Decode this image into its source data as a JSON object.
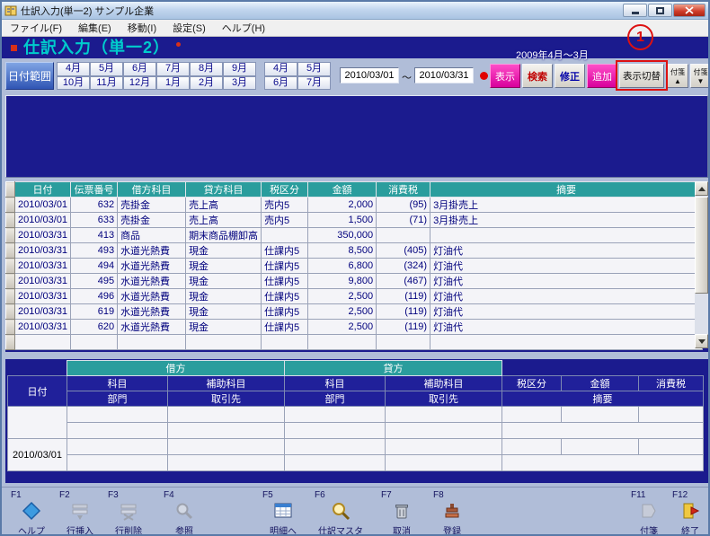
{
  "colors": {
    "navy": "#1b1b8e",
    "teal": "#2a9d9d",
    "magenta": "#d8009c",
    "annotation-red": "#dd1111",
    "cell-text": "#00007d"
  },
  "window": {
    "title": "仕訳入力(単一2) サンプル企業",
    "menus": [
      "ファイル(F)",
      "編集(E)",
      "移動(I)",
      "設定(S)",
      "ヘルプ(H)"
    ]
  },
  "header": {
    "title": "仕訳入力（単一2）",
    "period_label": "2009年4月～3月"
  },
  "annotation": {
    "number": "1"
  },
  "toolbar": {
    "date_range_label": "日付範囲",
    "months": [
      "4月",
      "5月",
      "6月",
      "7月",
      "8月",
      "9月",
      "10月",
      "11月",
      "12月",
      "1月",
      "2月",
      "3月"
    ],
    "quarter_months": [
      "4月",
      "5月",
      "6月",
      "7月"
    ],
    "date_from": "2010/03/01",
    "date_to": "2010/03/31",
    "tilde": "～",
    "buttons": {
      "display": "表示",
      "search": "検索",
      "modify": "修正",
      "add": "追加",
      "toggle_view": "表示切替",
      "fusen_up": "付箋▲",
      "fusen_down": "付箋▼"
    }
  },
  "journal_table": {
    "headers": [
      "日付",
      "伝票番号",
      "借方科目",
      "貸方科目",
      "税区分",
      "金額",
      "消費税",
      "摘要"
    ],
    "rows": [
      {
        "date": "2010/03/01",
        "no": "632",
        "debit": "売掛金",
        "credit": "売上高",
        "tax": "売内5",
        "amount": "2,000",
        "tax_amount": "(95)",
        "memo": "3月掛売上"
      },
      {
        "date": "2010/03/01",
        "no": "633",
        "debit": "売掛金",
        "credit": "売上高",
        "tax": "売内5",
        "amount": "1,500",
        "tax_amount": "(71)",
        "memo": "3月掛売上"
      },
      {
        "date": "2010/03/31",
        "no": "413",
        "debit": "商品",
        "credit": "期末商品棚卸高",
        "tax": "",
        "amount": "350,000",
        "tax_amount": "",
        "memo": ""
      },
      {
        "date": "2010/03/31",
        "no": "493",
        "debit": "水道光熱費",
        "credit": "現金",
        "tax": "仕課内5",
        "amount": "8,500",
        "tax_amount": "(405)",
        "memo": "灯油代"
      },
      {
        "date": "2010/03/31",
        "no": "494",
        "debit": "水道光熱費",
        "credit": "現金",
        "tax": "仕課内5",
        "amount": "6,800",
        "tax_amount": "(324)",
        "memo": "灯油代"
      },
      {
        "date": "2010/03/31",
        "no": "495",
        "debit": "水道光熱費",
        "credit": "現金",
        "tax": "仕課内5",
        "amount": "9,800",
        "tax_amount": "(467)",
        "memo": "灯油代"
      },
      {
        "date": "2010/03/31",
        "no": "496",
        "debit": "水道光熱費",
        "credit": "現金",
        "tax": "仕課内5",
        "amount": "2,500",
        "tax_amount": "(119)",
        "memo": "灯油代"
      },
      {
        "date": "2010/03/31",
        "no": "619",
        "debit": "水道光熱費",
        "credit": "現金",
        "tax": "仕課内5",
        "amount": "2,500",
        "tax_amount": "(119)",
        "memo": "灯油代"
      },
      {
        "date": "2010/03/31",
        "no": "620",
        "debit": "水道光熱費",
        "credit": "現金",
        "tax": "仕課内5",
        "amount": "2,500",
        "tax_amount": "(119)",
        "memo": "灯油代"
      },
      {
        "date": "",
        "no": "",
        "debit": "",
        "credit": "",
        "tax": "",
        "amount": "",
        "tax_amount": "",
        "memo": ""
      }
    ]
  },
  "entry_form": {
    "debit_header": "借方",
    "credit_header": "貸方",
    "col_date": "日付",
    "col_account": "科目",
    "col_sub": "補助科目",
    "col_dept": "部門",
    "col_partner": "取引先",
    "col_tax": "税区分",
    "col_amount": "金額",
    "col_tax_amount": "消費税",
    "col_memo": "摘要",
    "date_value": "2010/03/01"
  },
  "function_keys": [
    {
      "key": "F1",
      "label": "ヘルプ",
      "icon": "help",
      "enabled": true
    },
    {
      "key": "F2",
      "label": "行挿入",
      "icon": "insert_row",
      "enabled": false
    },
    {
      "key": "F3",
      "label": "行削除",
      "icon": "delete_row",
      "enabled": false
    },
    {
      "key": "F4",
      "label": "参照",
      "icon": "reference",
      "enabled": false
    },
    {
      "key": "F5",
      "label": "明細へ",
      "icon": "detail",
      "enabled": true
    },
    {
      "key": "F6",
      "label": "仕訳マスタ",
      "icon": "journal_master",
      "enabled": true
    },
    {
      "key": "F7",
      "label": "取消",
      "icon": "cancel",
      "enabled": true
    },
    {
      "key": "F8",
      "label": "登録",
      "icon": "register",
      "enabled": true
    },
    {
      "key": "F11",
      "label": "付箋",
      "icon": "fusen",
      "enabled": false
    },
    {
      "key": "F12",
      "label": "終了",
      "icon": "exit",
      "enabled": true
    }
  ]
}
